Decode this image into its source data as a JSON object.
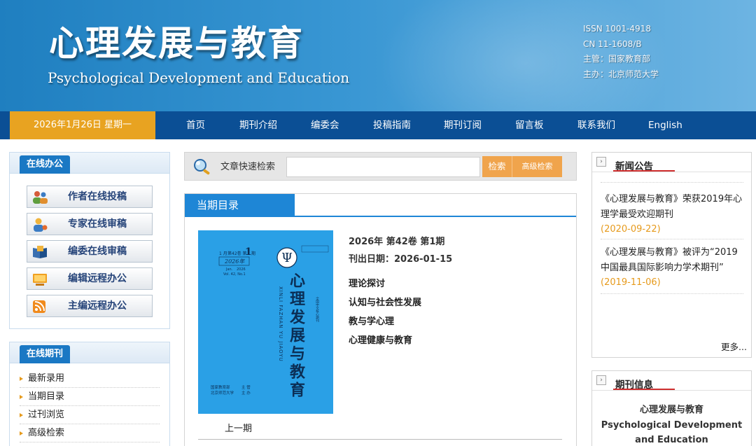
{
  "header": {
    "title_cn": "心理发展与教育",
    "title_en": "Psychological Development and Education",
    "issn": "ISSN 1001-4918",
    "cn": "CN 11-1608/B",
    "supervisor": "主管：国家教育部",
    "sponsor": "主办：北京师范大学"
  },
  "nav": {
    "date": "2026年1月26日 星期一",
    "items": [
      "首页",
      "期刊介绍",
      "编委会",
      "投稿指南",
      "期刊订阅",
      "留言板",
      "联系我们",
      "English"
    ]
  },
  "office": {
    "title": "在线办公",
    "buttons": [
      "作者在线投稿",
      "专家在线审稿",
      "编委在线审稿",
      "编辑远程办公",
      "主编远程办公"
    ]
  },
  "journal": {
    "title": "在线期刊",
    "items": [
      "最新录用",
      "当期目录",
      "过刊浏览",
      "高级检索"
    ]
  },
  "search": {
    "label": "文章快速检索",
    "placeholder": "",
    "search_button": "检索",
    "advanced_button": "高级检索"
  },
  "issue": {
    "tab": "当期目录",
    "volume": "2026年 第42卷 第1期",
    "pub_date": "刊出日期：2026-01-15",
    "categories": [
      "理论探讨",
      "认知与社会性发展",
      "教与学心理",
      "心理健康与教育"
    ],
    "prev": "上一期",
    "cover": {
      "issue_no": "1",
      "month": "1 月",
      "vol_label": "第42卷 第",
      "period": "期",
      "year": "2026年",
      "vol_en": "Vol. 42, No.1",
      "jan": "Jan.",
      "year_en": "2026",
      "title_vertical": "心理发展与教育",
      "pinyin_vertical": "XINLI FAZHAN YU JIAOYU",
      "small_vertical": "全国中文核心期刊",
      "pub_left1": "国家教育部",
      "pub_left2": "北京师范大学",
      "pub_right1": "主 管",
      "pub_right2": "主 办",
      "psi": "Ψ"
    },
    "accent": "#1e86d6"
  },
  "news": {
    "title": "新闻公告",
    "items": [
      {
        "text": "《心理发展与教育》荣获2019年心理学最受欢迎期刊",
        "date": "(2020-09-22)"
      },
      {
        "text": "《心理发展与教育》被评为“2019中国最具国际影响力学术期刊”",
        "date": "(2019-11-06)"
      }
    ],
    "more": "更多..."
  },
  "info": {
    "title": "期刊信息",
    "name_cn": "心理发展与教育",
    "name_en_1": "Psychological Development",
    "name_en_2": "and Education"
  }
}
